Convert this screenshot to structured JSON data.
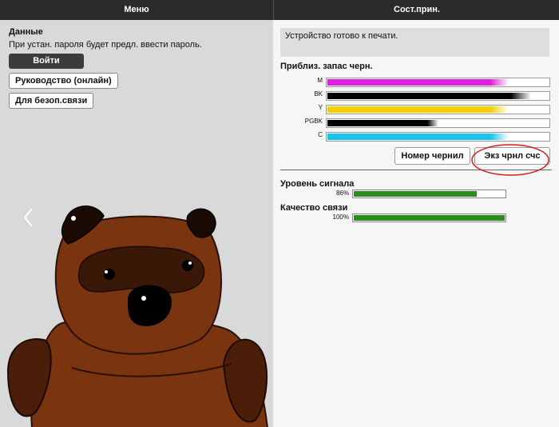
{
  "header": {
    "tab_menu": "Меню",
    "tab_status": "Сост.прин."
  },
  "left": {
    "title": "Данные",
    "hint": "При устан. пароля будет предл. ввести пароль.",
    "login_button": "Войти",
    "manual_button": "Руководство (онлайн)",
    "secure_button": "Для безоп.связи"
  },
  "right": {
    "status_message": "Устройство готово к печати.",
    "ink_title": "Приблиз. запас черн.",
    "inks": [
      {
        "label": "M",
        "color": "#e21ee2",
        "level": 0.82
      },
      {
        "label": "BK",
        "color": "#000000",
        "level": 0.92
      },
      {
        "label": "Y",
        "color": "#f2d000",
        "level": 0.82
      },
      {
        "label": "PGBK",
        "color": "#000000",
        "level": 0.5
      },
      {
        "label": "C",
        "color": "#17c4ec",
        "level": 0.82
      }
    ],
    "ink_number_button": "Номер чернил",
    "eco_button": "Экз чрнл счс",
    "signal_title": "Уровень сигнала",
    "signal_pct": "86%",
    "signal_level": 0.86,
    "quality_title": "Качество связи",
    "quality_pct": "100%",
    "quality_level": 1.0
  }
}
